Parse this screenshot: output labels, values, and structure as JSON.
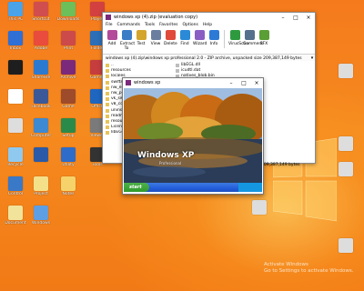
{
  "desktop": {
    "icons": [
      {
        "label": "This PC",
        "color": "#4aa3e8"
      },
      {
        "label": "Inbox",
        "color": "#2f6fd6"
      },
      {
        "label": "",
        "color": "#1e1e1e"
      },
      {
        "label": "",
        "color": "#fff"
      },
      {
        "label": "",
        "color": "#ddd"
      },
      {
        "label": "Recycle",
        "color": "#8fc9f0"
      },
      {
        "label": "Control",
        "color": "#3a78c8"
      },
      {
        "label": "Document",
        "color": "#f2e39a"
      },
      {
        "label": "Shortcut",
        "color": "#d14e4e"
      },
      {
        "label": "Adobe",
        "color": "#e94b3c"
      },
      {
        "label": "ShareFile",
        "color": "#2c7ad0"
      },
      {
        "label": "Facebook",
        "color": "#3b5998"
      },
      {
        "label": "Computer",
        "color": "#3d89d2"
      },
      {
        "label": "",
        "color": "#2b5aa8"
      },
      {
        "label": "Project",
        "color": "#f5e08a"
      },
      {
        "label": "Windows",
        "color": "#5e9fe3"
      },
      {
        "label": "Downloads",
        "color": "#6cbf59"
      },
      {
        "label": "Print",
        "color": "#cc4a4a"
      },
      {
        "label": "Archive",
        "color": "#7b2a7b"
      },
      {
        "label": "Game",
        "color": "#9e4b2c"
      },
      {
        "label": "Setup",
        "color": "#2a8a4a"
      },
      {
        "label": "Utility",
        "color": "#2e6cc9"
      },
      {
        "label": "Notes",
        "color": "#f6d36a"
      },
      {
        "label": "Player",
        "color": "#d24040"
      },
      {
        "label": "Folder",
        "color": "#2c6fb8"
      },
      {
        "label": "Games",
        "color": "#c63d3d"
      },
      {
        "label": "Office",
        "color": "#1e66c0"
      },
      {
        "label": "Viewer",
        "color": "#7a7a7a"
      },
      {
        "label": "Tools",
        "color": "#333"
      }
    ],
    "right_icons": [
      {
        "label": "",
        "color": "#ddd"
      },
      {
        "label": "",
        "color": "#ddd"
      },
      {
        "label": "",
        "color": "#ddd"
      },
      {
        "label": "",
        "color": "#ddd"
      },
      {
        "label": "",
        "color": "#ddd"
      }
    ],
    "watermark_line1": "Activate Windows",
    "watermark_line2": "Go to Settings to activate Windows."
  },
  "winrar": {
    "title": "windows xp (4).zip (evaluation copy)",
    "menu": [
      "File",
      "Commands",
      "Tools",
      "Favorites",
      "Options",
      "Help"
    ],
    "toolbar": [
      "Add",
      "Extract To",
      "Test",
      "View",
      "Delete",
      "Find",
      "Wizard",
      "Info",
      "VirusScan",
      "Comment",
      "SFX"
    ],
    "toolbar_colors": [
      "#b34a9a",
      "#3b7cc7",
      "#d3a52a",
      "#6a7fa0",
      "#e04a3a",
      "#2a8ad8",
      "#8a5fc4",
      "#2d7ad6",
      "#2e9a3f",
      "#55708c",
      "#5a9e36"
    ],
    "path": "windows xp (4).zip\\windows xp professional 2.0 - ZIP archive, unpacked size 209,387,149 bytes",
    "files": [
      "..",
      "resources",
      "locales",
      "swiftshader",
      "nw_elf",
      "nw_pers",
      "vk_swift",
      "v8_cont",
      "uninstall",
      "readme",
      "resourc",
      "License",
      "libEGL"
    ],
    "right_files": [
      "libEGL.dll",
      "icudtl.dat",
      "natives_blob.bin"
    ],
    "status": "209,387,149 bytes"
  },
  "xp_window": {
    "title": "windows xp",
    "logo_text": "Windows XP",
    "logo_sub": "Professional",
    "start_label": "start"
  }
}
